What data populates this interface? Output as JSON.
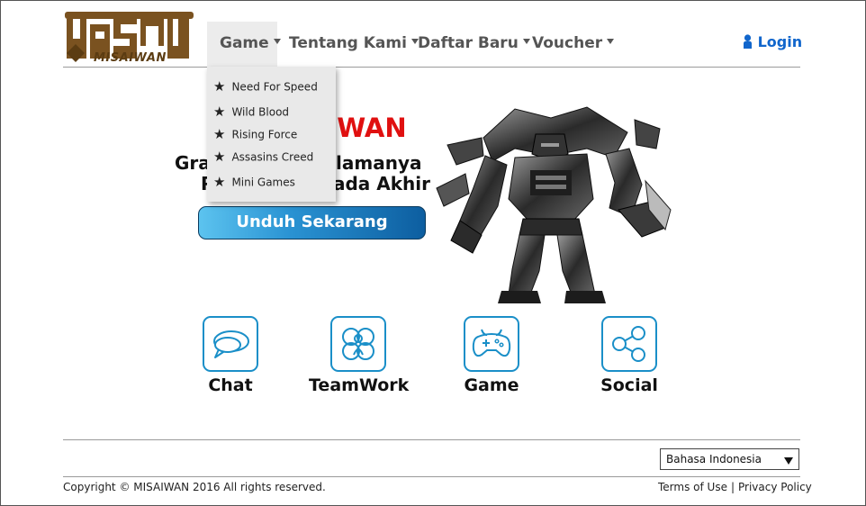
{
  "logo": {
    "text": "MISAIWAN",
    "color": "#7a5220"
  },
  "nav": {
    "items": [
      {
        "label": "Game"
      },
      {
        "label": "Tentang Kami"
      },
      {
        "label": "Daftar Baru"
      },
      {
        "label": "Voucher"
      }
    ],
    "login": "Login"
  },
  "dropdown": {
    "items": [
      {
        "label": "Need For Speed"
      },
      {
        "label": "Wild Blood"
      },
      {
        "label": "Rising Force"
      },
      {
        "label": "Assasins Creed"
      },
      {
        "label": "Mini Games"
      }
    ]
  },
  "hero": {
    "title": "AIWAN",
    "line1": "Gra                    lamanya",
    "line2": "P                   ada Akhir",
    "button": "Unduh Sekarang"
  },
  "features": [
    {
      "label": "Chat",
      "icon": "chat-icon"
    },
    {
      "label": "TeamWork",
      "icon": "teamwork-icon"
    },
    {
      "label": "Game",
      "icon": "gamepad-icon"
    },
    {
      "label": "Social",
      "icon": "share-icon"
    }
  ],
  "footer": {
    "language": "Bahasa Indonesia",
    "copyright": "Copyright © MISAIWAN 2016 All rights reserved.",
    "terms": "Terms of Use",
    "separator": "|",
    "privacy": "Privacy Policy"
  },
  "colors": {
    "accent": "#1a8fc8",
    "hero_title": "#e01010",
    "login": "#1166cc"
  }
}
